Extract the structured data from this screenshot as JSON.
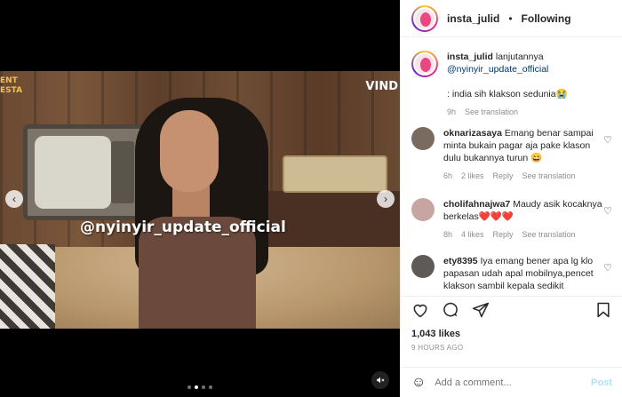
{
  "media": {
    "bg_text": "ENT\nESTA",
    "brand": "VIND",
    "watermark": "@nyinyir_update_official",
    "carousel": {
      "slides": 4,
      "active": 1
    }
  },
  "post": {
    "author": "insta_julid",
    "separator": "•",
    "follow_status": "Following",
    "caption": {
      "text": "lanjutannya",
      "mention": "@nyinyir_update_official",
      "line2": ": india sih klakson sedunia😭",
      "time": "9h",
      "see_translation": "See translation"
    },
    "likes": "1,043 likes",
    "ago": "9 HOURS AGO",
    "add_comment_placeholder": "Add a comment...",
    "post_label": "Post"
  },
  "comments": [
    {
      "user": "oknarizasaya",
      "text": "Emang benar sampai minta bukain pagar aja pake klason dulu bukannya turun 😄",
      "time": "6h",
      "likes": "2 likes",
      "reply": "Reply",
      "see_translation": "See translation"
    },
    {
      "user": "cholifahnajwa7",
      "text": "Maudy asik kocaknya berkelas❤️❤️❤️",
      "time": "8h",
      "likes": "4 likes",
      "reply": "Reply",
      "see_translation": "See translation"
    },
    {
      "user": "ety8395",
      "text": "Iya emang bener apa lg klo papasan udah apal mobilnya,pencet klakson sambil kepala sedikit",
      "time": "",
      "likes": "",
      "reply": "",
      "see_translation": ""
    }
  ],
  "colors": {
    "link": "#00376b",
    "meta": "#8e8e8e",
    "post_disabled": "#b2dffc"
  },
  "icons": [
    "chevron-left-icon",
    "chevron-right-icon",
    "mute-icon",
    "heart-icon",
    "comment-icon",
    "share-icon",
    "bookmark-icon",
    "emoji-icon",
    "more-icon"
  ]
}
